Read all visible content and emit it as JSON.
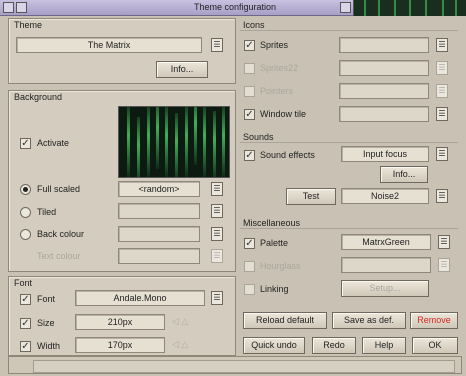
{
  "window": {
    "title": "Theme configuration"
  },
  "colors": {
    "remove_button_text": "#d52a1e",
    "titlebar": "#b7afd3",
    "panel_background": "#d4cdbf"
  },
  "theme": {
    "label": "Theme",
    "name_value": "The Matrix",
    "info_button": "Info..."
  },
  "background": {
    "label": "Background",
    "activate_label": "Activate",
    "activate_checked": true,
    "full_scaled_label": "Full scaled",
    "full_scaled_value": "<random>",
    "tiled_label": "Tiled",
    "back_colour_label": "Back colour",
    "text_colour_label": "Text colour",
    "selected_mode": "Full scaled"
  },
  "font": {
    "label": "Font",
    "font_label": "Font",
    "font_value": "Andale.Mono",
    "size_label": "Size",
    "size_value": "210px",
    "width_label": "Width",
    "width_value": "170px"
  },
  "icons": {
    "label": "Icons",
    "sprites_label": "Sprites",
    "sprites22_label": "Sprites22",
    "pointers_label": "Pointers",
    "window_tile_label": "Window tile"
  },
  "sounds": {
    "label": "Sounds",
    "sound_effects_label": "Sound effects",
    "sound_effects_value": "Input focus",
    "info_button": "Info...",
    "test_button": "Test",
    "test_value": "Noise2"
  },
  "misc": {
    "label": "Miscellaneous",
    "palette_label": "Palette",
    "palette_value": "MatrxGreen",
    "hourglass_label": "Hourglass",
    "linking_label": "Linking",
    "setup_button": "Setup..."
  },
  "actions": {
    "reload_default": "Reload default",
    "save_as_def": "Save as def.",
    "remove": "Remove",
    "quick_undo": "Quick undo",
    "redo": "Redo",
    "help": "Help",
    "ok": "OK"
  },
  "icon_names": [
    "close-icon",
    "toggle-size-icon",
    "menu-icon",
    "checkmark-icon",
    "stepper-arrows-icon"
  ]
}
